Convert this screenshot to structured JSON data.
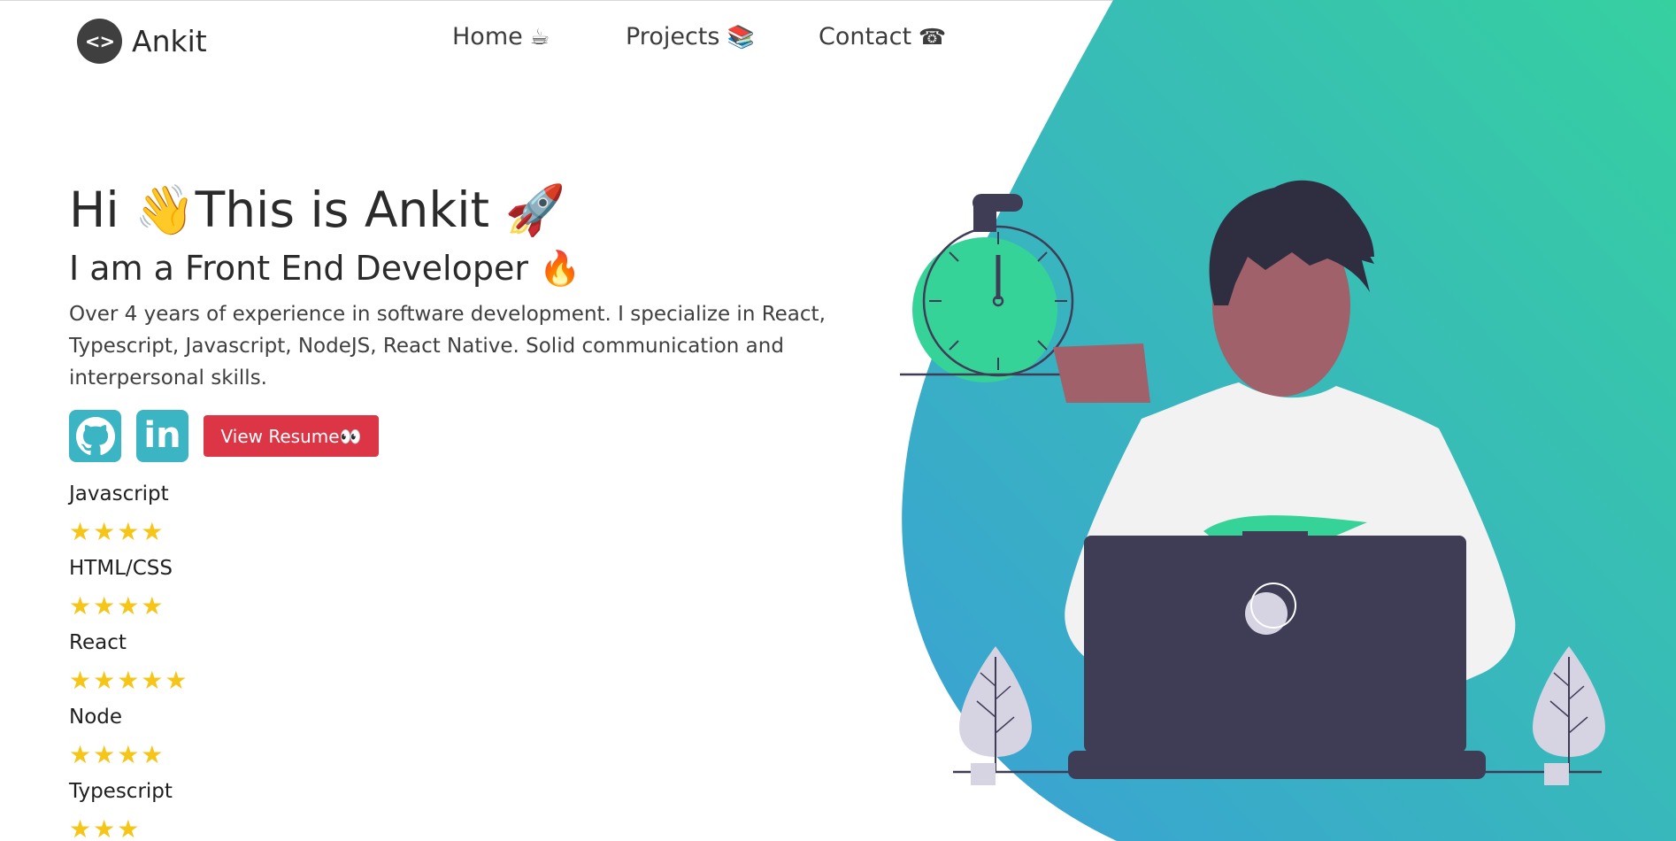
{
  "colors": {
    "accent_red": "#dc3545",
    "social_teal": "#3bb4c4",
    "star_gold": "#f5c518",
    "blob_start": "#3aa0d6",
    "blob_end": "#36d0a0"
  },
  "header": {
    "logo_icon": "<>",
    "logo_text": "Ankit",
    "nav": {
      "home_label": "Home",
      "home_icon": "☕",
      "projects_label": "Projects",
      "projects_icon": "📚",
      "contact_label": "Contact",
      "contact_icon": "☎"
    }
  },
  "hero": {
    "title": "Hi 👋This is Ankit 🚀",
    "subtitle": "I am a Front End Developer 🔥",
    "description": "Over 4 years of experience in software development. I specialize in React, Typescript, Javascript, NodeJS, React Native. Solid communication and interpersonal skills.",
    "social": {
      "github_icon": "github-icon",
      "linkedin_icon": "linkedin-icon",
      "linkedin_text": "in"
    },
    "resume_label": "View Resume👀"
  },
  "skills": [
    {
      "name": "Javascript",
      "rating": 4,
      "stars": "★★★★"
    },
    {
      "name": "HTML/CSS",
      "rating": 4,
      "stars": "★★★★"
    },
    {
      "name": "React",
      "rating": 5,
      "stars": "★★★★★"
    },
    {
      "name": "Node",
      "rating": 4,
      "stars": "★★★★"
    },
    {
      "name": "Typescript",
      "rating": 3,
      "stars": "★★★"
    }
  ],
  "illustration": {
    "subject": "person-at-laptop",
    "elements": [
      "stopwatch-icon",
      "plant-icon",
      "laptop-icon"
    ]
  }
}
